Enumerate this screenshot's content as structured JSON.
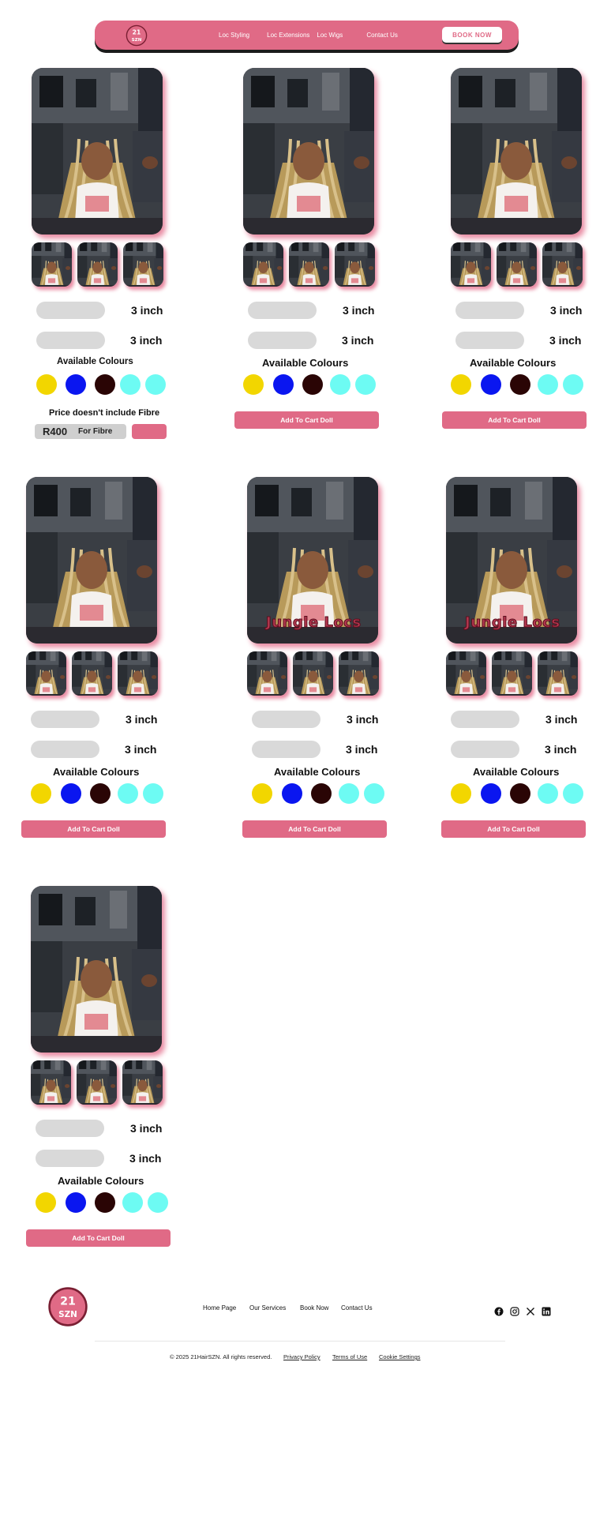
{
  "nav": {
    "links": [
      "Loc Styling",
      "Loc Extensions",
      "Loc Wigs",
      "Contact Us"
    ],
    "book_label": "BOOK NOW",
    "accent": "#e06a86"
  },
  "product": {
    "length_1": "3 inch",
    "length_2": "3 inch",
    "colours_title": "Available Colours",
    "swatches": [
      "#f2d600",
      "#0a16f0",
      "#2a0505",
      "#6dfbf3",
      "#6dfbf3"
    ],
    "cart_label": "Add To Cart Doll",
    "brand_overlay": "Jungle Locs"
  },
  "first_card": {
    "price_note": "Price doesn't include Fibre",
    "price": "R400",
    "price_suffix": "For Fibre"
  },
  "footer": {
    "links": [
      "Home Page",
      "Our Services",
      "Book Now",
      "Contact Us"
    ],
    "copyright": "© 2025 21HairSZN. All rights reserved.",
    "legal": [
      "Privacy Policy",
      "Terms of Use",
      "Cookie Settings"
    ],
    "socials": [
      "facebook-icon",
      "instagram-icon",
      "x-icon",
      "linkedin-icon"
    ]
  }
}
